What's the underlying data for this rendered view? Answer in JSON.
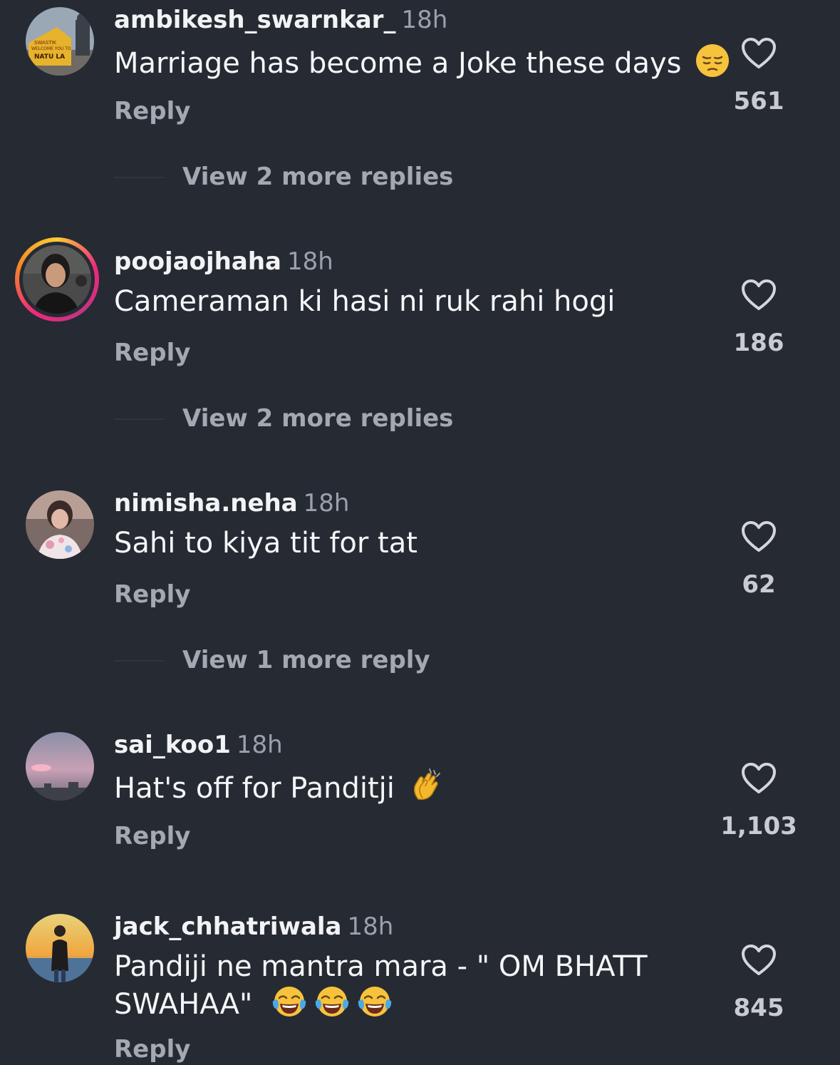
{
  "comments": [
    {
      "username": "ambikesh_swarnkar_",
      "time": "18h",
      "text": "Marriage has become a Joke these days",
      "emoji": "pensive-face",
      "reply_label": "Reply",
      "likes": "561",
      "more_replies": "View 2 more replies",
      "avatar_sign": [
        "SWASTIK",
        "WELCOME YOU TO",
        "NATU LA"
      ]
    },
    {
      "username": "poojaojhaha",
      "time": "18h",
      "text": "Cameraman ki hasi ni ruk rahi hogi",
      "reply_label": "Reply",
      "likes": "186",
      "more_replies": "View 2 more replies",
      "has_story": true
    },
    {
      "username": "nimisha.neha",
      "time": "18h",
      "text": "Sahi to kiya tit for tat",
      "reply_label": "Reply",
      "likes": "62",
      "more_replies": "View 1 more reply"
    },
    {
      "username": "sai_koo1",
      "time": "18h",
      "text": "Hat's off for Panditji",
      "emoji": "clapping-hands",
      "reply_label": "Reply",
      "likes": "1,103"
    },
    {
      "username": "jack_chhatriwala",
      "time": "18h",
      "text_line1": "Pandiji ne mantra mara - \" OM BHATT",
      "text_line2": "SWAHAA\"",
      "emoji": "face-with-tears-of-joy",
      "emoji_count": 3,
      "reply_label": "Reply",
      "likes": "845"
    }
  ],
  "colors": {
    "background": "#262a33",
    "primary_text": "#f5f6f8",
    "secondary_text": "#a4a8b1",
    "story_ring": "#ee2a7b"
  }
}
